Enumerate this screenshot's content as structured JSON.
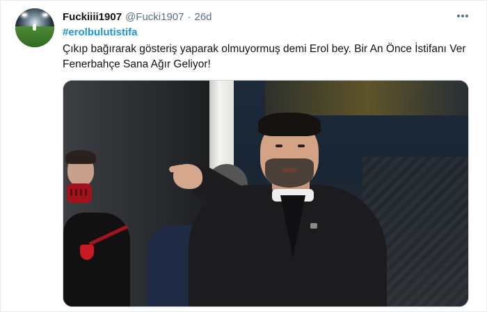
{
  "tweet": {
    "display_name": "Fuckiiii1907",
    "handle": "@Fucki1907",
    "separator": "·",
    "time": "26d",
    "hashtag": "#erolbulutistifa",
    "text": "Çıkıp bağırarak gösteriş yaparak olmuyormuş demi Erol bey. Bir An Önce İstifanı Ver Fenerbahçe Sana Ağır Geliyor!"
  },
  "icons": {
    "avatar": "stadium-avatar",
    "more": "more-horizontal-icon"
  },
  "colors": {
    "hashtag": "#1b95e0",
    "secondary_text": "#5b7083",
    "primary_text": "#0f1419"
  }
}
